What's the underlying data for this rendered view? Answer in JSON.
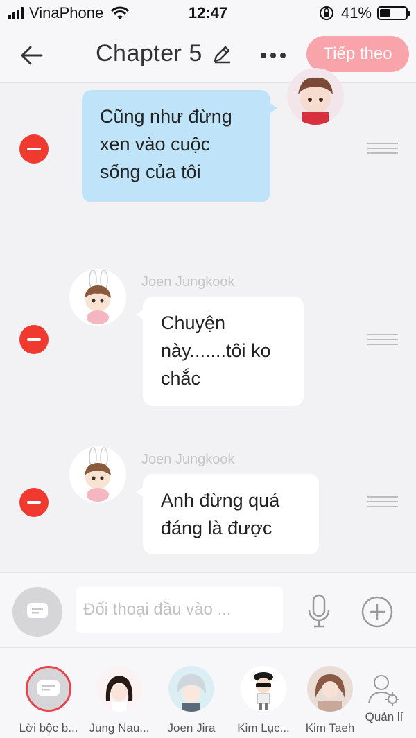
{
  "status_bar": {
    "carrier": "VinaPhone",
    "time": "12:47",
    "battery": "41%",
    "battery_level": 0.41
  },
  "header": {
    "title": "Chapter 5",
    "next_label": "Tiếp theo"
  },
  "messages": [
    {
      "text_lines": [
        "Cũng như đừng",
        "xen vào cuộc",
        "sống của tôi"
      ],
      "side": "right",
      "color": "#bfe3f8"
    },
    {
      "sender": "Joen Jungkook",
      "text_lines": [
        "Chuyện",
        "này.......tôi ko",
        "chắc"
      ],
      "side": "left"
    },
    {
      "sender": "Joen Jungkook",
      "text_lines": [
        "Anh đừng quá",
        "đáng là được"
      ],
      "side": "left"
    }
  ],
  "input": {
    "placeholder": "Đối thoại đầu vào ..."
  },
  "characters": [
    {
      "name": "Lời bộc b..."
    },
    {
      "name": "Jung Nau..."
    },
    {
      "name": "Joen Jira"
    },
    {
      "name": "Kim Lục..."
    },
    {
      "name": "Kim Taeh"
    },
    {
      "name": "Quản lí"
    }
  ],
  "colors": {
    "accent_pink": "#f9a3aa",
    "delete_red": "#f03a30",
    "bubble_blue": "#bfe3f8"
  }
}
